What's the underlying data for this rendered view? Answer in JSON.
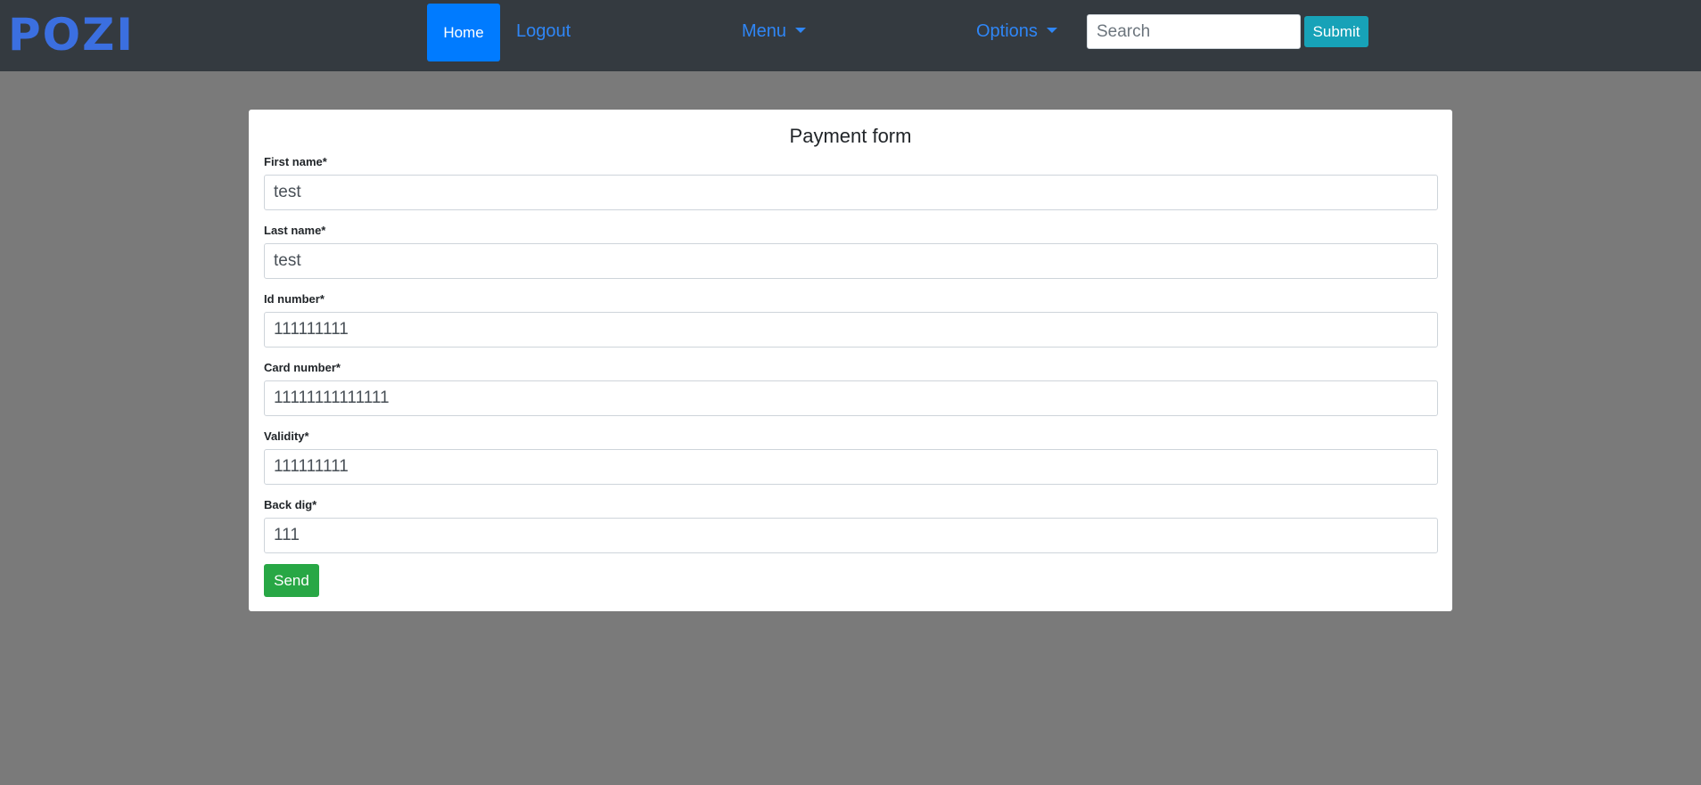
{
  "navbar": {
    "logo": "POZI",
    "home_label": "Home",
    "logout_label": "Logout",
    "menu_label": "Menu",
    "options_label": "Options",
    "search_placeholder": "Search",
    "submit_label": "Submit"
  },
  "form": {
    "title": "Payment form",
    "fields": [
      {
        "label": "First name*",
        "value": "test"
      },
      {
        "label": "Last name*",
        "value": "test"
      },
      {
        "label": "Id number*",
        "value": "111111111"
      },
      {
        "label": "Card number*",
        "value": "11111111111111"
      },
      {
        "label": "Validity*",
        "value": "111111111"
      },
      {
        "label": "Back dig*",
        "value": "111"
      }
    ],
    "send_label": "Send"
  },
  "colors": {
    "navbar_bg": "#343a40",
    "page_bg": "#7a7a7a",
    "primary": "#007bff",
    "link": "#2f86f6",
    "info": "#17a2b8",
    "success": "#28a745",
    "logo": "#3b6fe0"
  }
}
